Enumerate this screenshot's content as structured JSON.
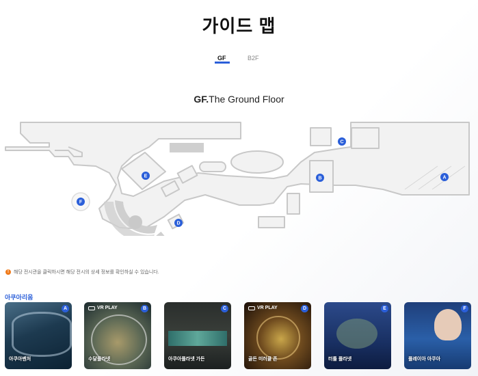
{
  "page": {
    "title": "가이드 맵"
  },
  "tabs": [
    {
      "label": "GF",
      "active": true
    },
    {
      "label": "B2F",
      "active": false
    }
  ],
  "floor": {
    "code": "GF.",
    "name": "The Ground Floor"
  },
  "map_markers": [
    "A",
    "B",
    "C",
    "D",
    "E",
    "F"
  ],
  "notice": {
    "icon": "!",
    "text": "해당 전시관을 클릭하시면 해당 전시의 상세 정보를 확인하실 수 있습니다."
  },
  "section": {
    "label": "아쿠아리움"
  },
  "cards": [
    {
      "badge": "A",
      "name": "아쿠아벤처",
      "vr": ""
    },
    {
      "badge": "B",
      "name": "수달플라넷",
      "vr": "VR PLAY"
    },
    {
      "badge": "C",
      "name": "아쿠아플라넷 가든",
      "vr": ""
    },
    {
      "badge": "D",
      "name": "골든 미러클 존",
      "vr": "VR PLAY"
    },
    {
      "badge": "E",
      "name": "터틀 플라넷",
      "vr": ""
    },
    {
      "badge": "F",
      "name": "플레이아 아쿠아",
      "vr": ""
    }
  ],
  "colors": {
    "accent": "#2b5fd9",
    "notice": "#f07a1a",
    "map_stroke": "#c9c9c9",
    "map_fill": "#f0f0f0"
  }
}
